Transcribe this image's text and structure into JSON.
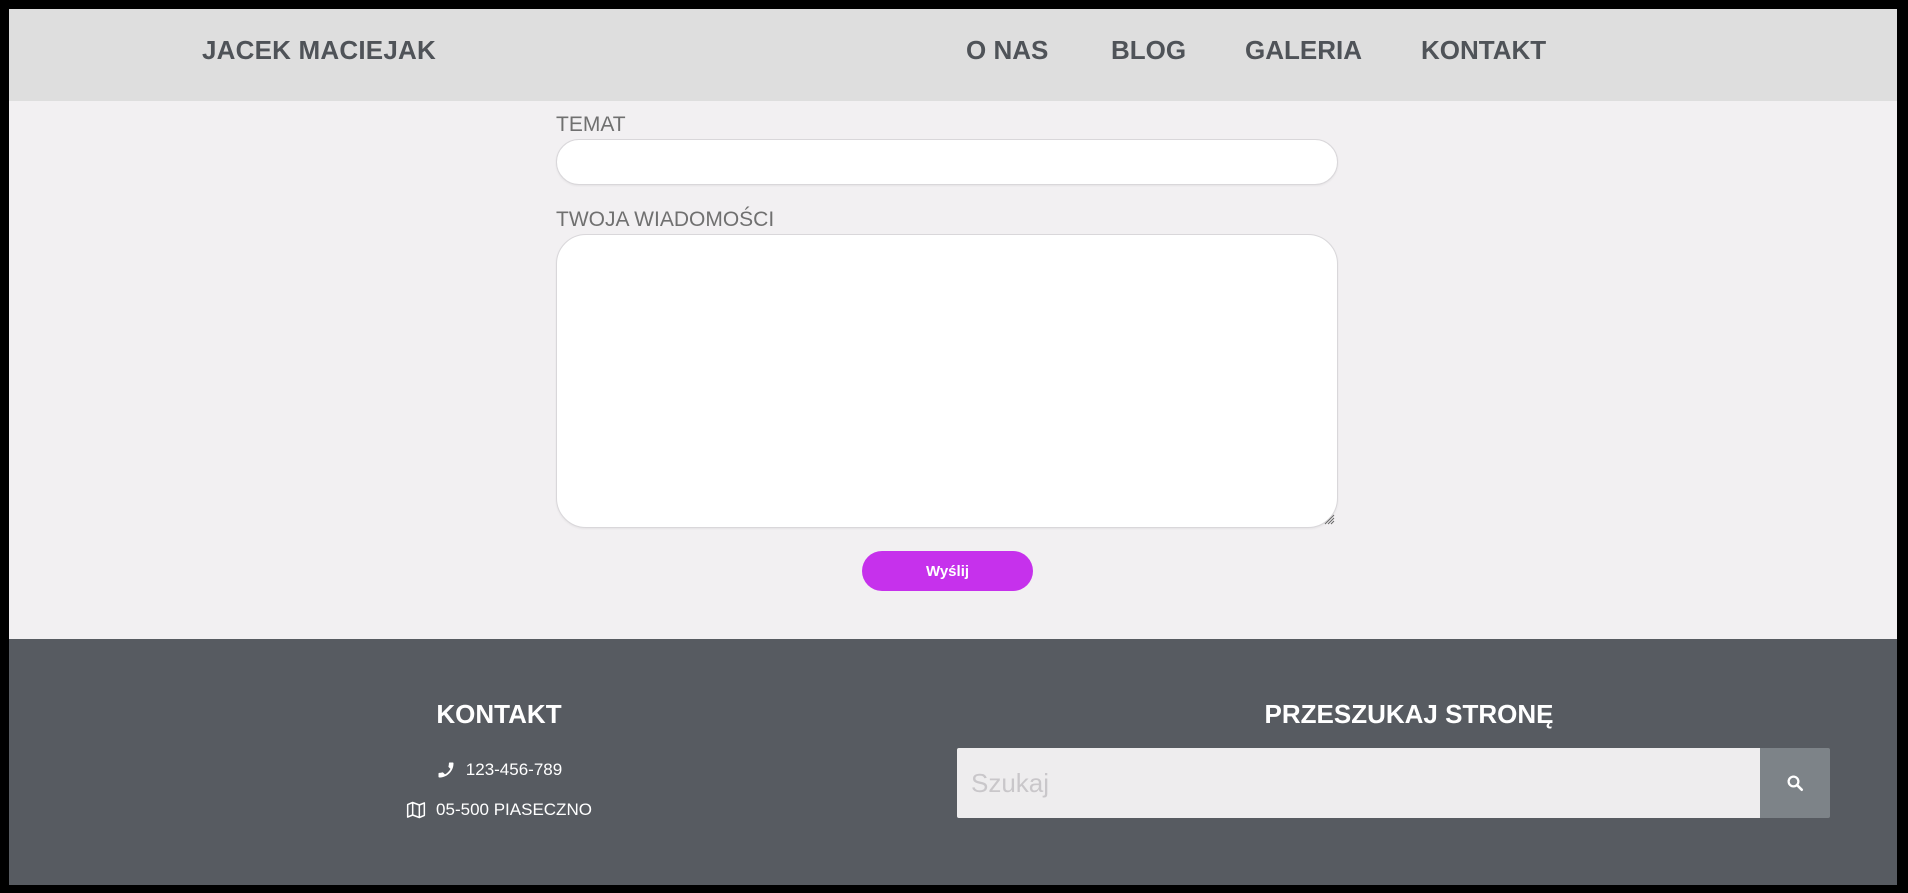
{
  "header": {
    "brand": "JACEK MACIEJAK",
    "nav": [
      "O NAS",
      "BLOG",
      "GALERIA",
      "KONTAKT"
    ]
  },
  "form": {
    "subject_label": "TEMAT",
    "subject_value": "",
    "message_label": "TWOJA WIADOMOŚCI",
    "message_value": "",
    "submit_label": "Wyślij"
  },
  "footer": {
    "contact_title": "KONTAKT",
    "phone": "123-456-789",
    "address": "05-500 PIASECZNO",
    "search_title": "PRZESZUKAJ STRONĘ",
    "search_placeholder": "Szukaj"
  },
  "icons": {
    "phone": "phone-icon",
    "map": "map-icon",
    "search": "search-icon"
  },
  "colors": {
    "accent": "#c631ec",
    "header_bg": "#dedede",
    "footer_bg": "#575b61",
    "search_button": "#7d8388"
  }
}
